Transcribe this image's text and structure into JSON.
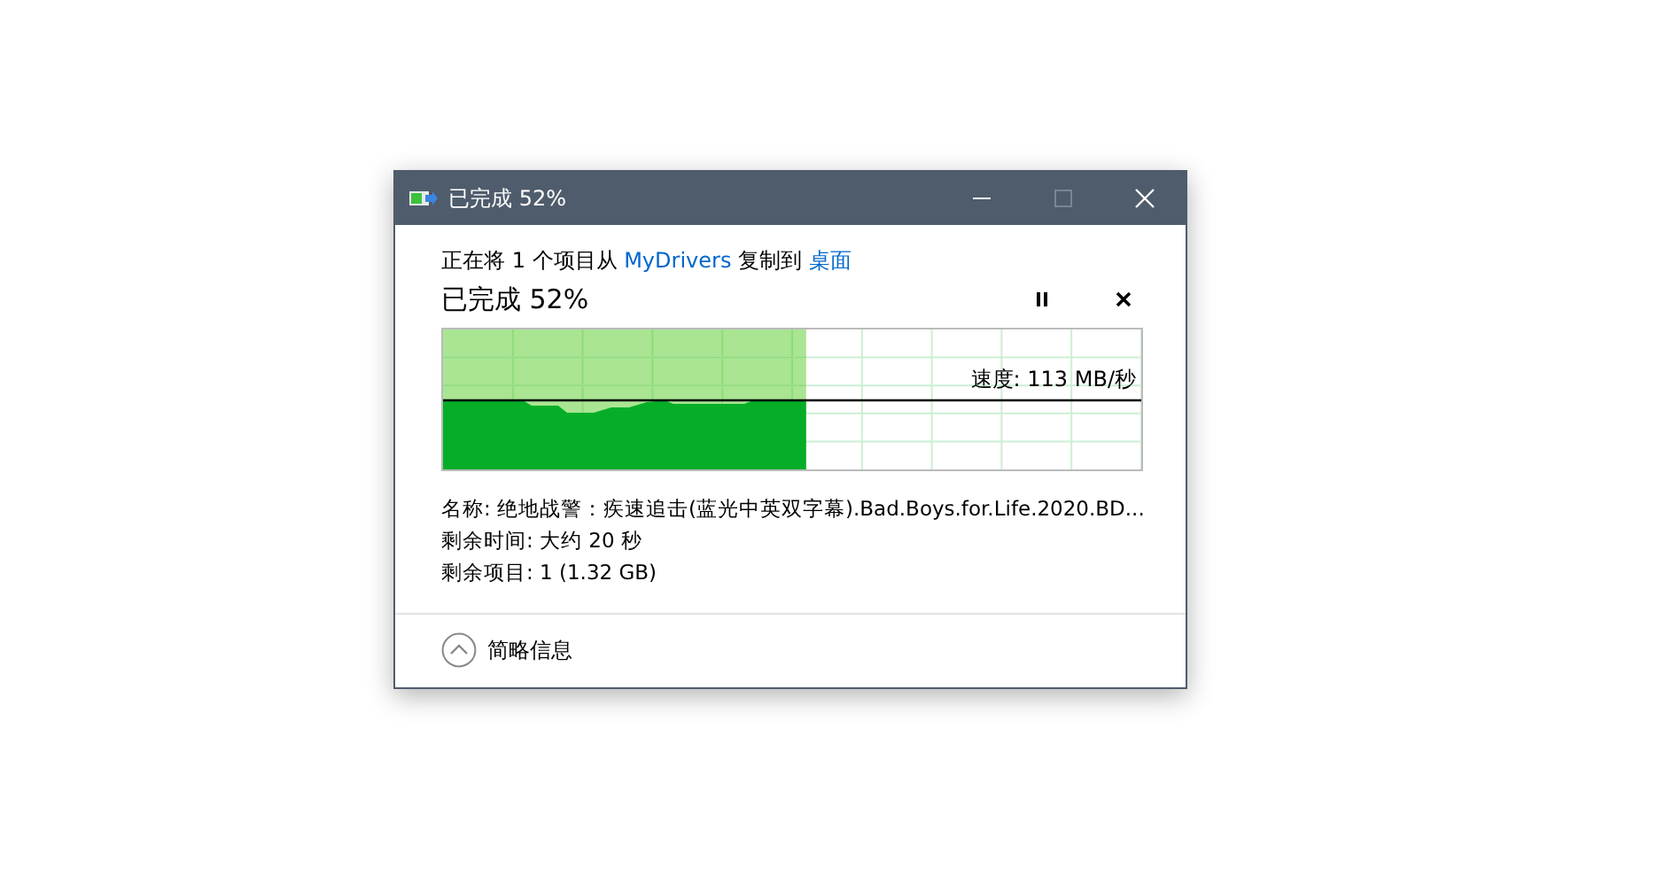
{
  "window": {
    "title": "已完成 52%"
  },
  "description": [
    {
      "kind": "text",
      "text": "正在将 1 个项目从 "
    },
    {
      "kind": "link",
      "text": "MyDrivers"
    },
    {
      "kind": "text",
      "text": " 复制到 "
    },
    {
      "kind": "link",
      "text": "桌面"
    }
  ],
  "heading": "已完成 52%",
  "progress": {
    "level": 0.52,
    "speed": "速度: 113 MB/秒"
  },
  "details": [
    "名称: 绝地战警：疾速追击(蓝光中英双字幕).Bad.Boys.for.Life.2020.BD...",
    "剩余时间: 大约 20 秒",
    "剩余项目: 1 (1.32 GB)"
  ],
  "footer": {
    "label": "简略信息"
  }
}
